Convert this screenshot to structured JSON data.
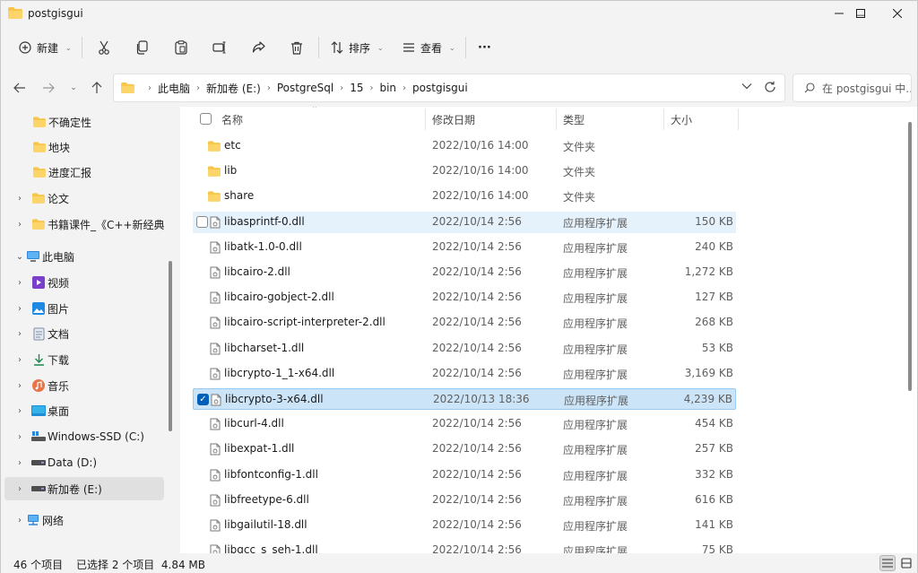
{
  "window": {
    "title": "postgisgui",
    "minimize": "—",
    "maximize": "☐",
    "close": "✕"
  },
  "toolbar": {
    "new_label": "新建",
    "sort_label": "排序",
    "view_label": "查看",
    "more_label": "···"
  },
  "address": {
    "crumbs": [
      "此电脑",
      "新加卷 (E:)",
      "PostgreSql",
      "15",
      "bin",
      "postgisgui"
    ],
    "search_placeholder": "在 postgisgui 中..."
  },
  "sidebar": {
    "items": [
      {
        "label": "不确定性",
        "icon": "folder-icon",
        "has_chevron": false
      },
      {
        "label": "地块",
        "icon": "folder-icon",
        "has_chevron": false
      },
      {
        "label": "进度汇报",
        "icon": "folder-icon",
        "has_chevron": false
      },
      {
        "label": "论文",
        "icon": "folder-icon",
        "has_chevron": true
      },
      {
        "label": "书籍课件_《C++新经典》_",
        "icon": "folder-icon",
        "has_chevron": true
      },
      {
        "label": "此电脑",
        "icon": "computer-icon",
        "has_chevron": true,
        "expanded": true
      },
      {
        "label": "视频",
        "icon": "video-icon",
        "has_chevron": true
      },
      {
        "label": "图片",
        "icon": "pictures-icon",
        "has_chevron": true
      },
      {
        "label": "文档",
        "icon": "documents-icon",
        "has_chevron": true
      },
      {
        "label": "下载",
        "icon": "download-icon",
        "has_chevron": true
      },
      {
        "label": "音乐",
        "icon": "music-icon",
        "has_chevron": true
      },
      {
        "label": "桌面",
        "icon": "desktop-icon",
        "has_chevron": true
      },
      {
        "label": "Windows-SSD (C:)",
        "icon": "system-drive-icon",
        "has_chevron": true
      },
      {
        "label": "Data (D:)",
        "icon": "drive-icon",
        "has_chevron": true
      },
      {
        "label": "新加卷 (E:)",
        "icon": "drive-icon",
        "has_chevron": true,
        "selected": true
      },
      {
        "label": "网络",
        "icon": "network-icon",
        "has_chevron": true
      }
    ]
  },
  "columns": {
    "name": "名称",
    "date": "修改日期",
    "type": "类型",
    "size": "大小"
  },
  "files": [
    {
      "name": "etc",
      "date": "2022/10/16 14:00",
      "type": "文件夹",
      "size": "",
      "kind": "folder"
    },
    {
      "name": "lib",
      "date": "2022/10/16 14:00",
      "type": "文件夹",
      "size": "",
      "kind": "folder"
    },
    {
      "name": "share",
      "date": "2022/10/16 14:00",
      "type": "文件夹",
      "size": "",
      "kind": "folder"
    },
    {
      "name": "libasprintf-0.dll",
      "date": "2022/10/14 2:56",
      "type": "应用程序扩展",
      "size": "150 KB",
      "kind": "dll",
      "state": "hover"
    },
    {
      "name": "libatk-1.0-0.dll",
      "date": "2022/10/14 2:56",
      "type": "应用程序扩展",
      "size": "240 KB",
      "kind": "dll"
    },
    {
      "name": "libcairo-2.dll",
      "date": "2022/10/14 2:56",
      "type": "应用程序扩展",
      "size": "1,272 KB",
      "kind": "dll"
    },
    {
      "name": "libcairo-gobject-2.dll",
      "date": "2022/10/14 2:56",
      "type": "应用程序扩展",
      "size": "127 KB",
      "kind": "dll"
    },
    {
      "name": "libcairo-script-interpreter-2.dll",
      "date": "2022/10/14 2:56",
      "type": "应用程序扩展",
      "size": "268 KB",
      "kind": "dll"
    },
    {
      "name": "libcharset-1.dll",
      "date": "2022/10/14 2:56",
      "type": "应用程序扩展",
      "size": "53 KB",
      "kind": "dll"
    },
    {
      "name": "libcrypto-1_1-x64.dll",
      "date": "2022/10/14 2:56",
      "type": "应用程序扩展",
      "size": "3,169 KB",
      "kind": "dll"
    },
    {
      "name": "libcrypto-3-x64.dll",
      "date": "2022/10/13 18:36",
      "type": "应用程序扩展",
      "size": "4,239 KB",
      "kind": "dll",
      "state": "selected"
    },
    {
      "name": "libcurl-4.dll",
      "date": "2022/10/14 2:56",
      "type": "应用程序扩展",
      "size": "454 KB",
      "kind": "dll"
    },
    {
      "name": "libexpat-1.dll",
      "date": "2022/10/14 2:56",
      "type": "应用程序扩展",
      "size": "257 KB",
      "kind": "dll"
    },
    {
      "name": "libfontconfig-1.dll",
      "date": "2022/10/14 2:56",
      "type": "应用程序扩展",
      "size": "332 KB",
      "kind": "dll"
    },
    {
      "name": "libfreetype-6.dll",
      "date": "2022/10/14 2:56",
      "type": "应用程序扩展",
      "size": "616 KB",
      "kind": "dll"
    },
    {
      "name": "libgailutil-18.dll",
      "date": "2022/10/14 2:56",
      "type": "应用程序扩展",
      "size": "141 KB",
      "kind": "dll"
    },
    {
      "name": "libgcc_s_seh-1.dll",
      "date": "2022/10/14 2:56",
      "type": "应用程序扩展",
      "size": "75 KB",
      "kind": "dll"
    }
  ],
  "status": {
    "item_count": "46 个项目",
    "selection": "已选择 2 个项目  4.84 MB"
  },
  "colors": {
    "accent": "#005fb8",
    "folder": "#f8c548",
    "selected_row": "#cce4f7",
    "hover_row": "#e5f1fb"
  }
}
